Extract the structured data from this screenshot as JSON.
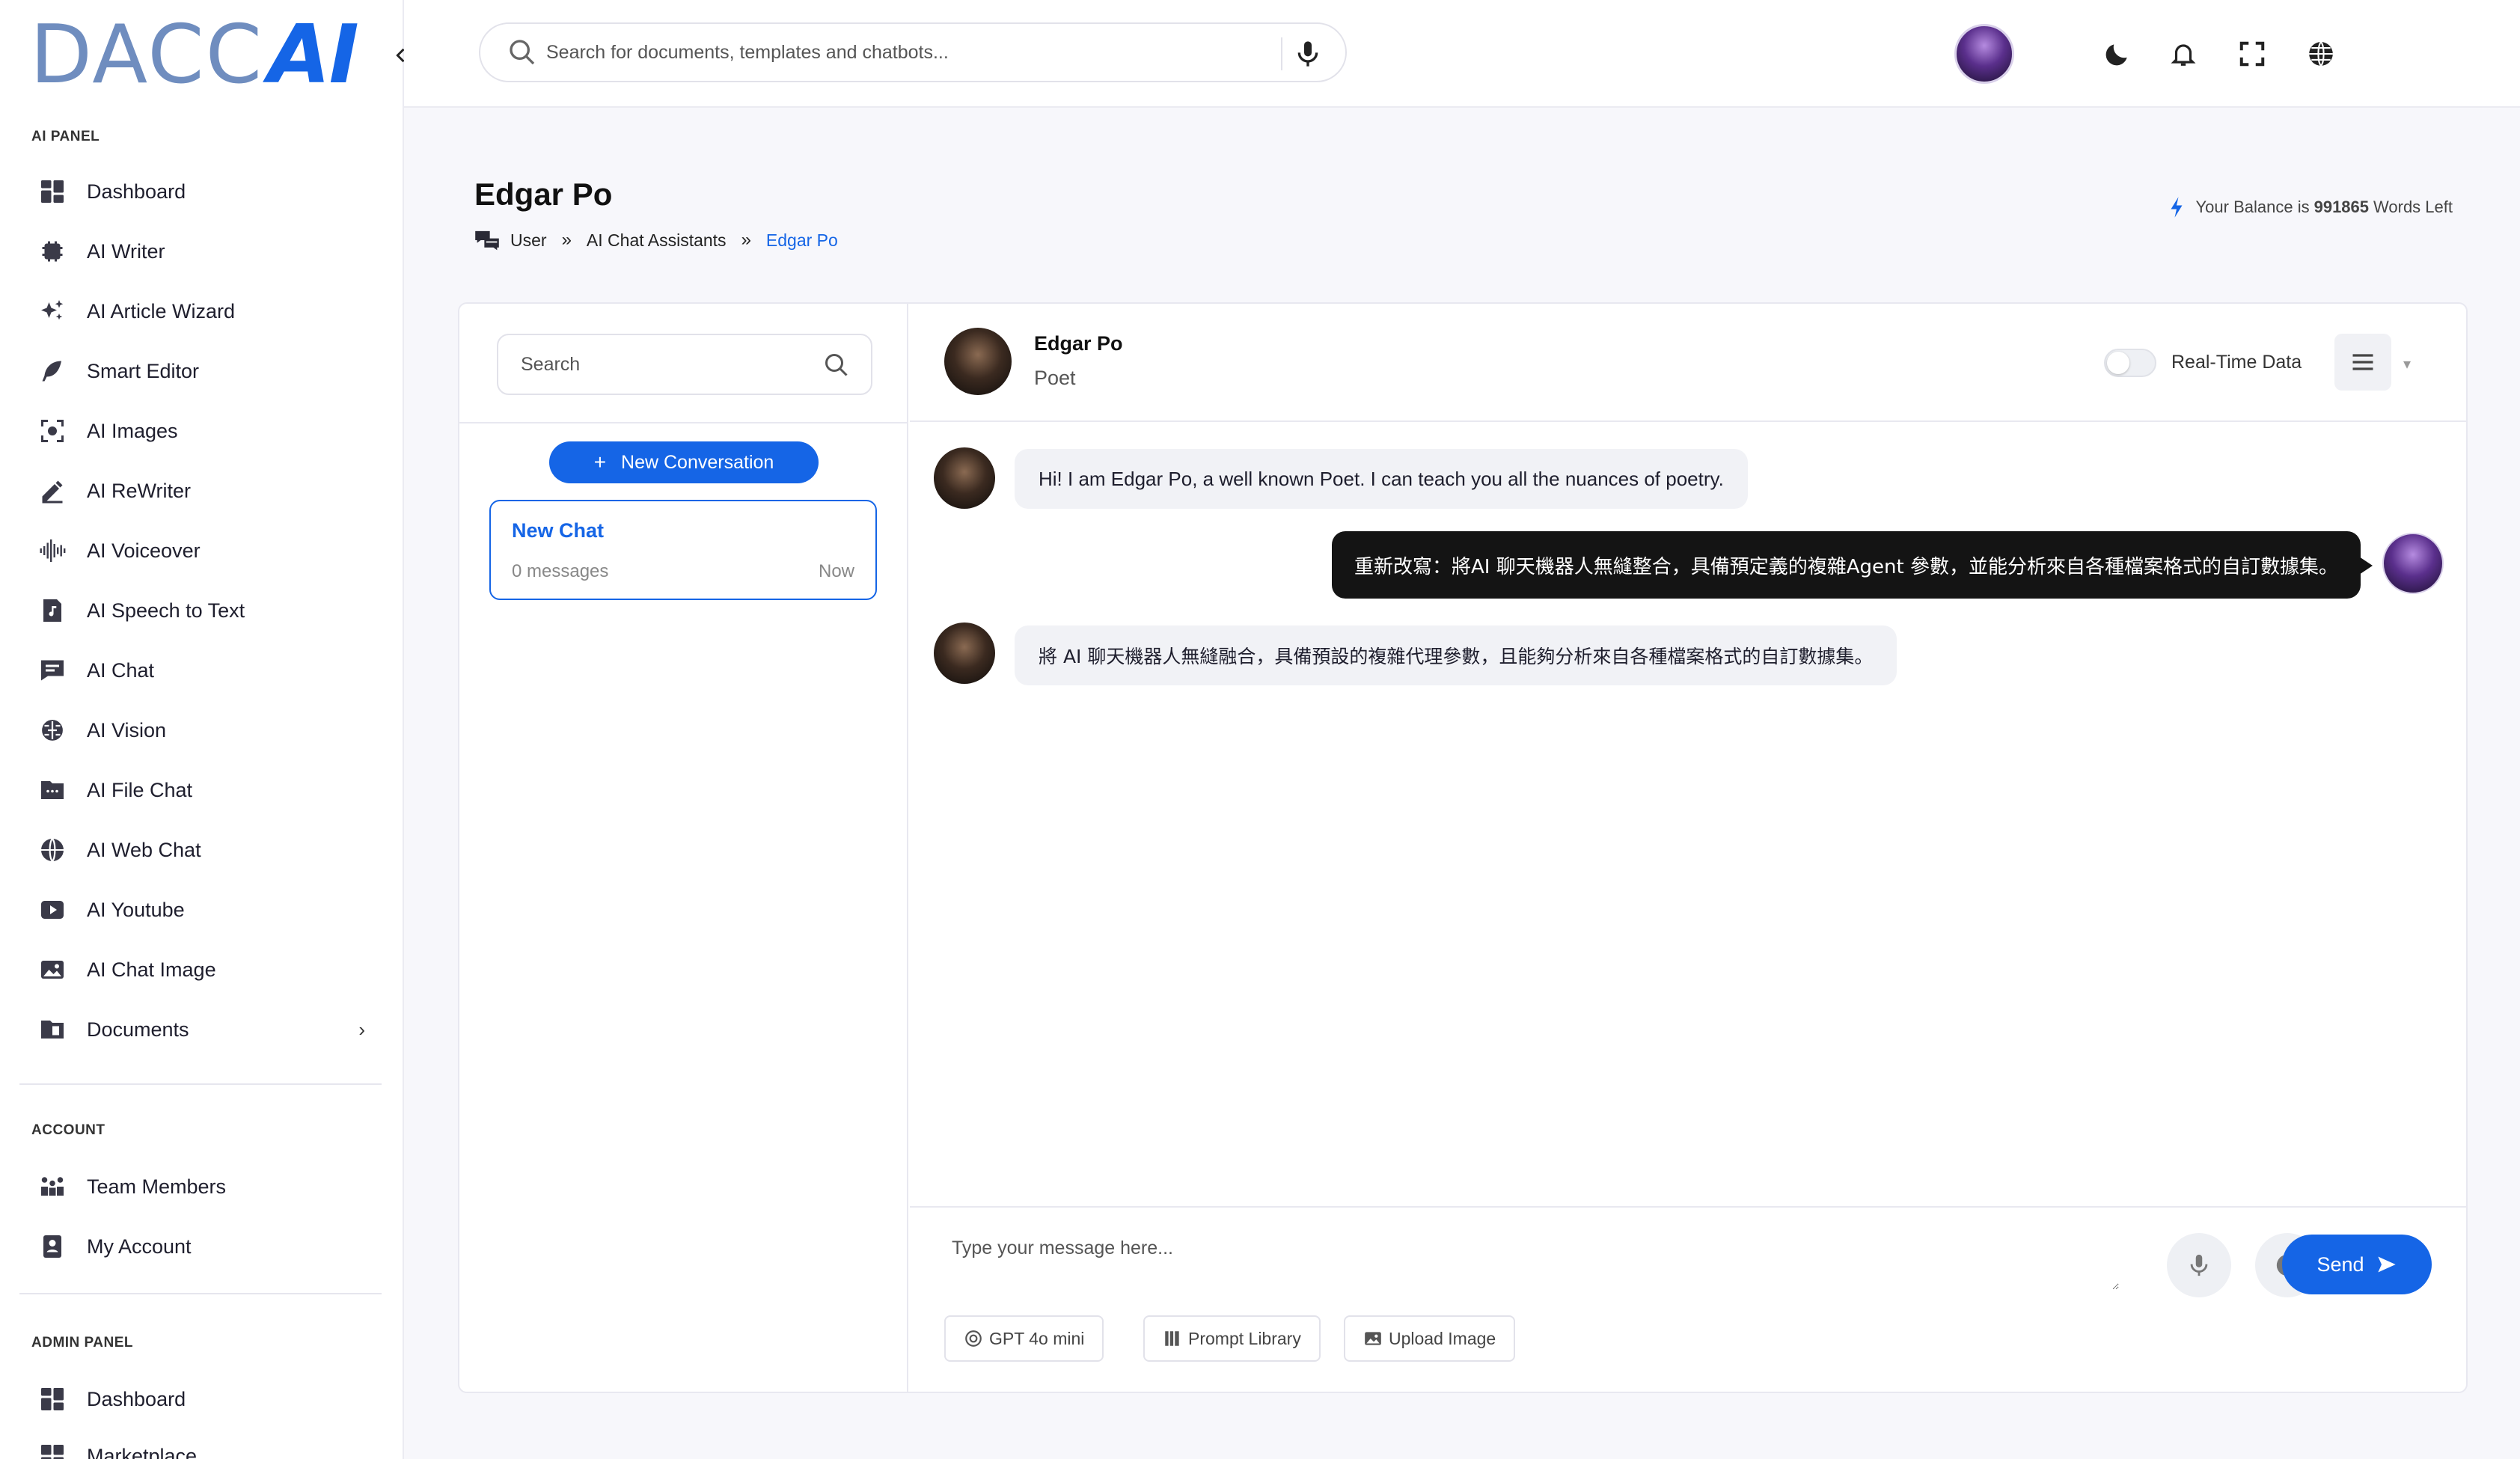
{
  "brand": {
    "logo_text": "DACC",
    "logo_ai": "AI"
  },
  "sidebar": {
    "sections": {
      "ai_panel": "AI PANEL",
      "account": "ACCOUNT",
      "admin_panel": "ADMIN PANEL"
    },
    "ai_items": [
      {
        "label": "Dashboard",
        "icon": "dashboard-icon"
      },
      {
        "label": "AI Writer",
        "icon": "chip-icon"
      },
      {
        "label": "AI Article Wizard",
        "icon": "sparkles-icon"
      },
      {
        "label": "Smart Editor",
        "icon": "feather-icon"
      },
      {
        "label": "AI Images",
        "icon": "image-scan-icon"
      },
      {
        "label": "AI ReWriter",
        "icon": "pen-icon"
      },
      {
        "label": "AI Voiceover",
        "icon": "waveform-icon"
      },
      {
        "label": "AI Speech to Text",
        "icon": "audio-file-icon"
      },
      {
        "label": "AI Chat",
        "icon": "chat-icon"
      },
      {
        "label": "AI Vision",
        "icon": "brain-icon"
      },
      {
        "label": "AI File Chat",
        "icon": "folder-icon"
      },
      {
        "label": "AI Web Chat",
        "icon": "globe-icon"
      },
      {
        "label": "AI Youtube",
        "icon": "youtube-icon"
      },
      {
        "label": "AI Chat Image",
        "icon": "picture-icon"
      },
      {
        "label": "Documents",
        "icon": "documents-icon"
      }
    ],
    "account_items": [
      {
        "label": "Team Members",
        "icon": "team-icon"
      },
      {
        "label": "My Account",
        "icon": "account-icon"
      }
    ],
    "admin_items": [
      {
        "label": "Dashboard",
        "icon": "dashboard-icon"
      },
      {
        "label": "Marketplace",
        "icon": "marketplace-icon"
      }
    ]
  },
  "topbar": {
    "search_placeholder": "Search for documents, templates and chatbots..."
  },
  "page": {
    "title": "Edgar Po",
    "breadcrumb": [
      "User",
      "AI Chat Assistants",
      "Edgar Po"
    ],
    "balance_prefix": "Your Balance is",
    "balance_value": "991865",
    "balance_suffix": "Words Left"
  },
  "conversations": {
    "search_placeholder": "Search",
    "new_button": "New Conversation",
    "items": [
      {
        "title": "New Chat",
        "count": "0 messages",
        "time": "Now"
      }
    ]
  },
  "chat": {
    "bot_name": "Edgar Po",
    "bot_role": "Poet",
    "realtime_label": "Real-Time Data",
    "realtime_on": false,
    "messages": [
      {
        "from": "bot",
        "text": "Hi! I am Edgar Po, a well known Poet. I can teach you all the nuances of poetry."
      },
      {
        "from": "user",
        "text": "重新改寫：將AI 聊天機器人無縫整合，具備預定義的複雜Agent 參數，並能分析來自各種檔案格式的自訂數據集。"
      },
      {
        "from": "bot",
        "text": "將 AI 聊天機器人無縫融合，具備預設的複雜代理參數，且能夠分析來自各種檔案格式的自訂數據集。"
      }
    ],
    "composer_placeholder": "Type your message here...",
    "send_label": "Send",
    "chips": [
      "GPT 4o mini",
      "Prompt Library",
      "Upload Image"
    ]
  },
  "colors": {
    "accent": "#1565e6",
    "user_bubble": "#141414",
    "bot_bubble": "#f1f2f6"
  }
}
